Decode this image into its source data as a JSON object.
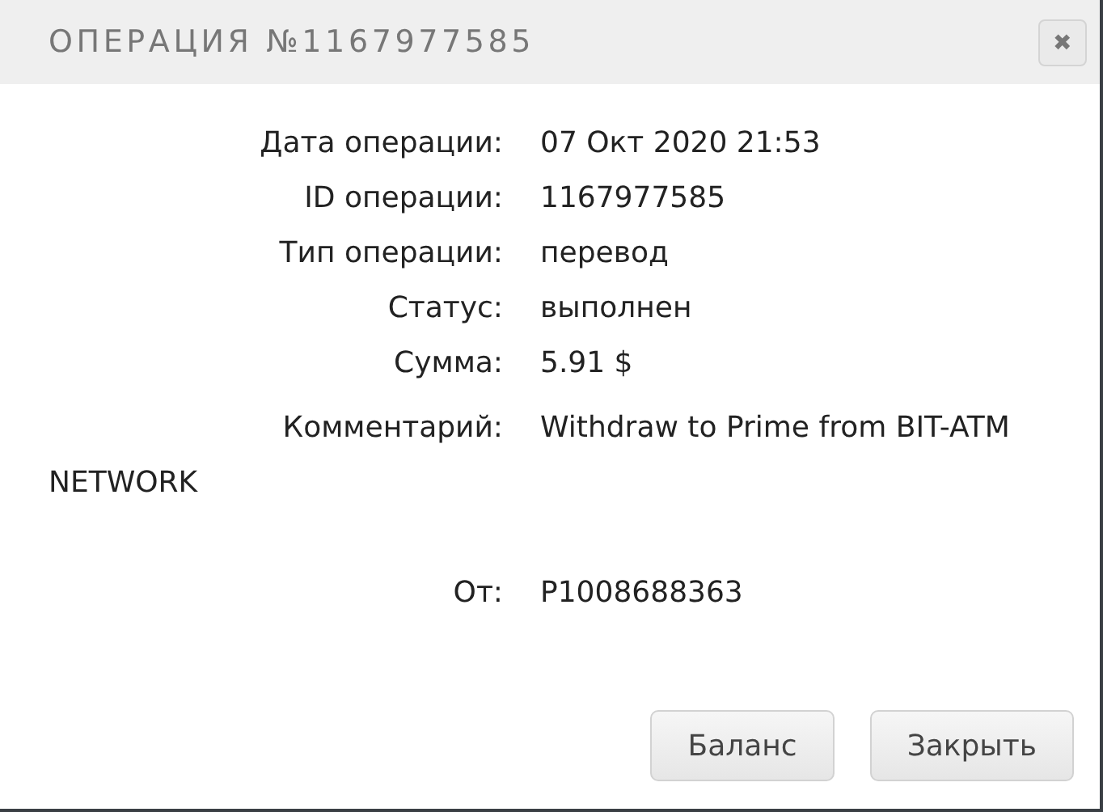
{
  "dialog": {
    "title": "ОПЕРАЦИЯ №1167977585",
    "close": "✖"
  },
  "details": [
    {
      "kind": "row",
      "label": "Дата операции:",
      "value": "07 Окт 2020 21:53"
    },
    {
      "kind": "row",
      "label": "ID операции:",
      "value": "1167977585"
    },
    {
      "kind": "row",
      "label": "Тип операции:",
      "value": "перевод"
    },
    {
      "kind": "row",
      "label": "Статус:",
      "value": "выполнен"
    },
    {
      "kind": "row",
      "label": "Сумма:",
      "value": "5.91 $"
    },
    {
      "kind": "wrap",
      "label": "Комментарий:",
      "value": "Withdraw to Prime from BIT-ATM NETWORK"
    },
    {
      "kind": "spaced",
      "label": "От:",
      "value": "P1008688363"
    }
  ],
  "buttons": [
    "Баланс",
    "Закрыть"
  ]
}
